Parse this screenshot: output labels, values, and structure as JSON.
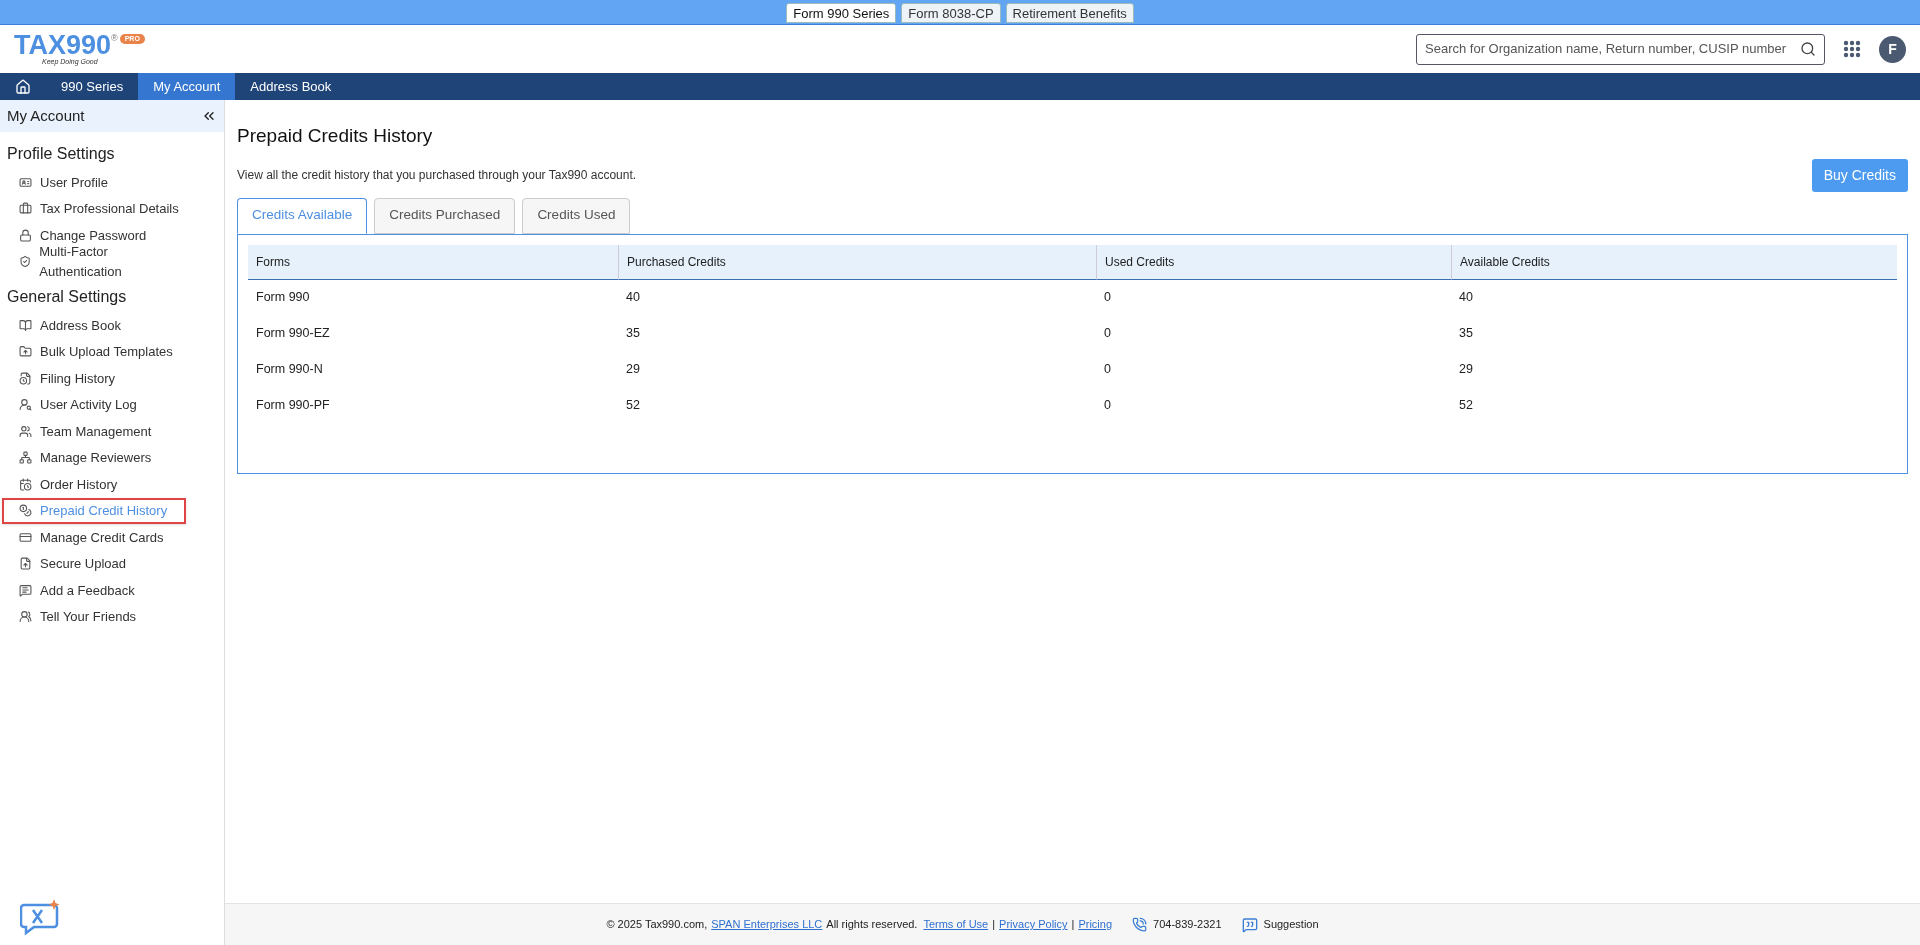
{
  "top_bar": {
    "tabs": [
      {
        "label": "Form 990 Series",
        "selected": true
      },
      {
        "label": "Form 8038-CP",
        "selected": false
      },
      {
        "label": "Retirement Benefits",
        "selected": false
      }
    ]
  },
  "header": {
    "logo": {
      "name": "TAX990",
      "mark": "®",
      "badge": "PRO",
      "tagline": "Keep Doing Good"
    },
    "search": {
      "placeholder": "Search for Organization name, Return number, CUSIP number"
    },
    "avatar": "F"
  },
  "nav": {
    "items": [
      {
        "kind": "home",
        "selected": false
      },
      {
        "kind": "text",
        "label": "990 Series",
        "selected": false
      },
      {
        "kind": "text",
        "label": "My Account",
        "selected": true
      },
      {
        "kind": "text",
        "label": "Address Book",
        "selected": false
      }
    ]
  },
  "sidebar": {
    "title": "My Account",
    "sections": [
      {
        "title": "Profile Settings",
        "items": [
          {
            "label": "User Profile",
            "selected": false
          },
          {
            "label": "Tax Professional Details",
            "selected": false
          },
          {
            "label": "Change Password",
            "selected": false
          },
          {
            "label": "Multi-Factor Authentication",
            "selected": false
          }
        ]
      },
      {
        "title": "General Settings",
        "items": [
          {
            "label": "Address Book",
            "selected": false
          },
          {
            "label": "Bulk Upload Templates",
            "selected": false
          },
          {
            "label": "Filing History",
            "selected": false
          },
          {
            "label": "User Activity Log",
            "selected": false
          },
          {
            "label": "Team Management",
            "selected": false
          },
          {
            "label": "Manage Reviewers",
            "selected": false
          },
          {
            "label": "Order History",
            "selected": false
          },
          {
            "label": "Prepaid Credit History",
            "selected": true
          },
          {
            "label": "Manage Credit Cards",
            "selected": false
          },
          {
            "label": "Secure Upload",
            "selected": false
          },
          {
            "label": "Add a Feedback",
            "selected": false
          },
          {
            "label": "Tell Your Friends",
            "selected": false
          }
        ]
      }
    ]
  },
  "page": {
    "title": "Prepaid Credits History",
    "description": "View all the credit history that you purchased through your Tax990 account.",
    "buy_button": "Buy Credits",
    "tabs": [
      {
        "label": "Credits Available",
        "selected": true
      },
      {
        "label": "Credits Purchased",
        "selected": false
      },
      {
        "label": "Credits Used",
        "selected": false
      }
    ],
    "table": {
      "columns": [
        "Forms",
        "Purchased Credits",
        "Used Credits",
        "Available Credits"
      ],
      "rows": [
        [
          "Form 990",
          "40",
          "0",
          "40"
        ],
        [
          "Form 990-EZ",
          "35",
          "0",
          "35"
        ],
        [
          "Form 990-N",
          "29",
          "0",
          "29"
        ],
        [
          "Form 990-PF",
          "52",
          "0",
          "52"
        ]
      ]
    }
  },
  "footer": {
    "copyright": "© 2025 Tax990.com,",
    "company_link": "SPAN Enterprises LLC",
    "rights": "All rights reserved.",
    "links": [
      {
        "kind": "link",
        "text": "Terms of Use"
      },
      {
        "kind": "separator",
        "text": "|"
      },
      {
        "kind": "link",
        "text": "Privacy Policy"
      },
      {
        "kind": "separator",
        "text": "|"
      },
      {
        "kind": "link",
        "text": "Pricing"
      }
    ],
    "phone": "704-839-2321",
    "suggestion": "Suggestion"
  }
}
